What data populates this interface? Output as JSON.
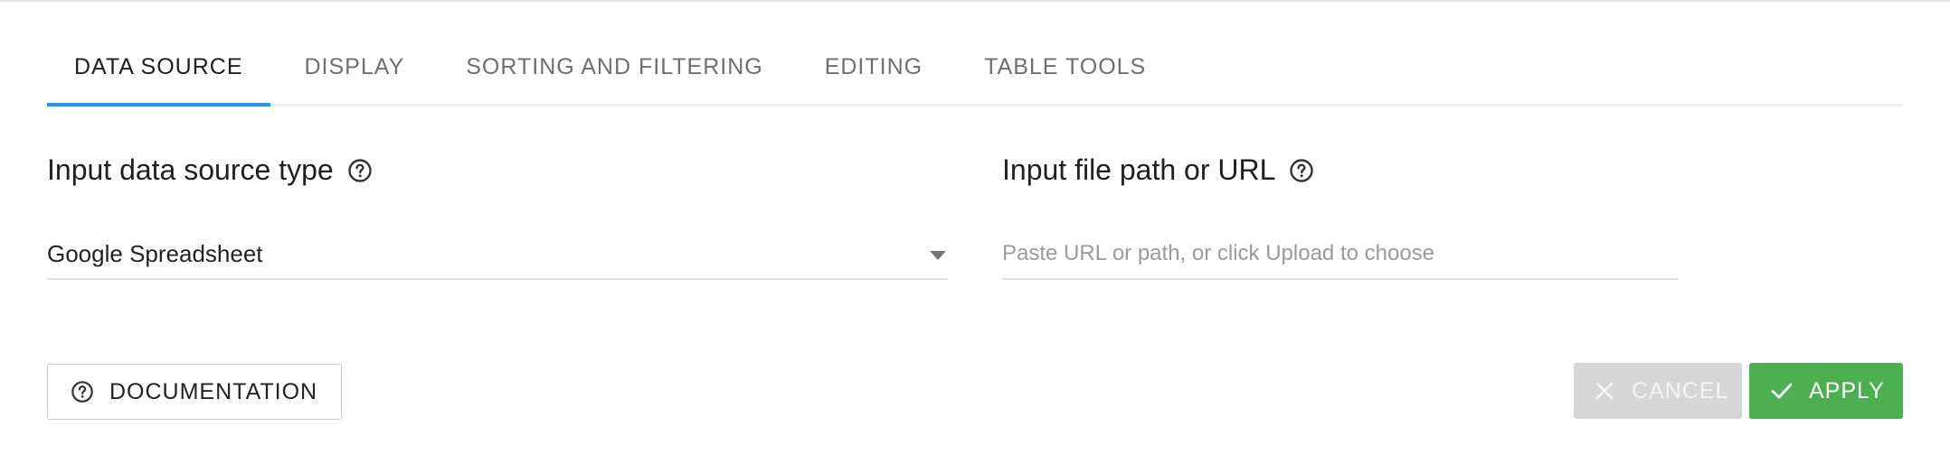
{
  "tabs": [
    {
      "label": "DATA SOURCE",
      "active": true
    },
    {
      "label": "DISPLAY",
      "active": false
    },
    {
      "label": "SORTING AND FILTERING",
      "active": false
    },
    {
      "label": "EDITING",
      "active": false
    },
    {
      "label": "TABLE TOOLS",
      "active": false
    }
  ],
  "source_type": {
    "title": "Input data source type",
    "help_icon": "help-circle-icon",
    "selected": "Google Spreadsheet",
    "caret_icon": "caret-down-icon"
  },
  "file_path": {
    "title": "Input file path or URL",
    "help_icon": "help-circle-icon",
    "value": "",
    "placeholder": "Paste URL or path, or click Upload to choose"
  },
  "buttons": {
    "documentation": {
      "label": "DOCUMENTATION",
      "icon": "help-circle-icon"
    },
    "cancel": {
      "label": "CANCEL",
      "icon": "close-icon"
    },
    "apply": {
      "label": "APPLY",
      "icon": "check-icon"
    }
  },
  "colors": {
    "accent": "#2196f3",
    "apply": "#4caf50",
    "cancel_disabled": "#d6d6d6"
  }
}
